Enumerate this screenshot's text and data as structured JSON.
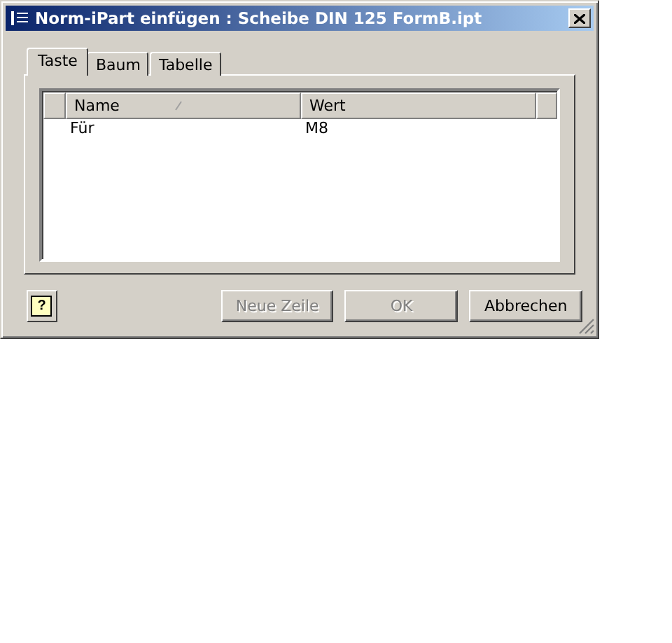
{
  "window": {
    "title": "Norm-iPart einfügen : Scheibe DIN 125 FormB.ipt"
  },
  "tabs": [
    {
      "label": "Taste",
      "selected": true
    },
    {
      "label": "Baum",
      "selected": false
    },
    {
      "label": "Tabelle",
      "selected": false
    }
  ],
  "list": {
    "columns": [
      "Name",
      "Wert"
    ],
    "rows": [
      {
        "cells": [
          "Für",
          "M8"
        ]
      }
    ]
  },
  "help_button": {
    "label": "?"
  },
  "buttons": [
    {
      "label": "Neue Zeile",
      "disabled": true
    },
    {
      "label": "OK",
      "disabled": true
    },
    {
      "label": "Abbrechen",
      "disabled": false
    }
  ]
}
